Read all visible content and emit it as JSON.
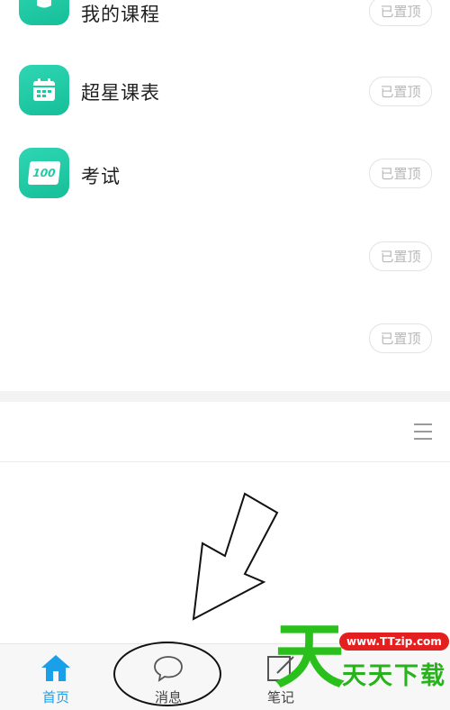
{
  "rows": [
    {
      "label": "我的课程",
      "pin": "已置顶",
      "icon": "graduation-cap-icon"
    },
    {
      "label": "超星课表",
      "pin": "已置顶",
      "icon": "calendar-icon"
    },
    {
      "label": "考试",
      "pin": "已置顶",
      "icon": "exam-score-icon",
      "icon_text": "100"
    },
    {
      "label": "",
      "pin": "已置顶"
    },
    {
      "label": "",
      "pin": "已置顶"
    }
  ],
  "tabbar": {
    "home": "首页",
    "messages": "消息",
    "notes": "笔记"
  },
  "watermark": {
    "glyph": "天",
    "url": "www.TTzip.com",
    "text": "天天下载"
  },
  "colors": {
    "accent": "#1aa0e8",
    "icon_green": "#1fc9a4",
    "watermark_green": "#29c01b",
    "watermark_red": "#e31f1f"
  }
}
